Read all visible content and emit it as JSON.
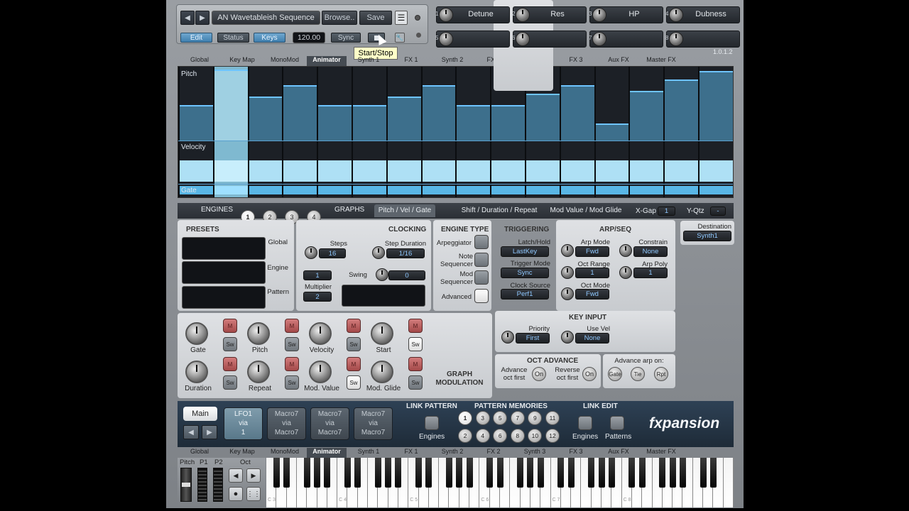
{
  "toolbar": {
    "prev": "◀",
    "next": "▶",
    "preset": "AN Wavetableish Sequence",
    "browse": "Browse..",
    "save": "Save",
    "edit": "Edit",
    "status": "Status",
    "keys": "Keys",
    "tempo": "120.00",
    "sync": "Sync",
    "version": "1.0.1.2",
    "tooltip": "Start/Stop"
  },
  "macros": [
    {
      "num": "1",
      "label": "Detune"
    },
    {
      "num": "2",
      "label": "Res"
    },
    {
      "num": "3",
      "label": "HP"
    },
    {
      "num": "4",
      "label": "Dubness"
    },
    {
      "num": "5",
      "label": ""
    },
    {
      "num": "6",
      "label": ""
    },
    {
      "num": "7",
      "label": ""
    },
    {
      "num": "8",
      "label": ""
    }
  ],
  "tabs": [
    "Global",
    "Key Map",
    "MonoMod",
    "Animator",
    "Synth 1",
    "FX 1",
    "Synth 2",
    "FX 2",
    "Synth 3",
    "FX 3",
    "Aux FX",
    "Master FX"
  ],
  "active_tab": "Animator",
  "graph": {
    "pitch_label": "Pitch",
    "velocity_label": "Velocity",
    "gate_label": "Gate",
    "pitch_values": [
      0.5,
      1.0,
      0.62,
      0.78,
      0.5,
      0.5,
      0.62,
      0.78,
      0.5,
      0.5,
      0.66,
      0.78,
      0.24,
      0.7,
      0.86,
      0.98
    ],
    "velocity_values": [
      0.55,
      1.0,
      0.55,
      0.55,
      0.55,
      0.55,
      0.55,
      0.55,
      0.55,
      0.55,
      0.55,
      0.55,
      0.55,
      0.55,
      0.55,
      0.55
    ],
    "gate_values": [
      1,
      1,
      1,
      1,
      1,
      1,
      1,
      1,
      1,
      1,
      1,
      1,
      1,
      1,
      1,
      1
    ]
  },
  "engines": {
    "label": "ENGINES",
    "items": [
      "1",
      "2",
      "3",
      "4"
    ],
    "active": "1"
  },
  "graphs": {
    "label": "GRAPHS",
    "items": [
      "Pitch / Vel / Gate",
      "Shift / Duration / Repeat",
      "Mod Value / Mod Glide"
    ],
    "active": "Pitch / Vel / Gate"
  },
  "xgap": {
    "label": "X-Gap",
    "value": "1"
  },
  "yqtz": {
    "label": "Y-Qtz",
    "value": "-"
  },
  "destination": {
    "label": "Destination",
    "value": "Synth1"
  },
  "presets": {
    "title": "PRESETS",
    "global": "Global",
    "engine": "Engine",
    "pattern": "Pattern"
  },
  "clocking": {
    "title": "CLOCKING",
    "steps_label": "Steps",
    "steps": "16",
    "step_duration_label": "Step Duration",
    "step_duration": "1/16",
    "swing_label": "Swing",
    "swing": "0",
    "mult_a": "1",
    "multiplier_label": "Multiplier",
    "multiplier": "2"
  },
  "engine_type": {
    "title": "ENGINE TYPE",
    "items": [
      "Arpeggiator",
      "Note Sequencer",
      "Mod Sequencer",
      "Advanced"
    ]
  },
  "triggering": {
    "title": "TRIGGERING",
    "latch_label": "Latch/Hold",
    "latch": "LastKey",
    "trigger_label": "Trigger Mode",
    "trigger": "Sync",
    "clock_label": "Clock Source",
    "clock": "Perf1"
  },
  "arpseq": {
    "title": "ARP/SEQ",
    "arp_mode_label": "Arp Mode",
    "arp_mode": "Fwd",
    "constrain_label": "Constrain",
    "constrain": "None",
    "oct_range_label": "Oct Range",
    "oct_range": "1",
    "arp_poly_label": "Arp Poly",
    "arp_poly": "1",
    "oct_mode_label": "Oct Mode",
    "oct_mode": "Fwd"
  },
  "key_input": {
    "title": "KEY INPUT",
    "priority_label": "Priority",
    "priority": "First",
    "use_vel_label": "Use Vel",
    "use_vel": "None"
  },
  "oct_advance": {
    "title": "OCT ADVANCE",
    "adv_label": "Advance oct first",
    "rev_label": "Reverse oct first",
    "on": "On"
  },
  "advance_arp": {
    "title": "Advance arp on:",
    "items": [
      "Gate",
      "Tie",
      "Rpt"
    ]
  },
  "graph_mod": {
    "title": "GRAPH MODULATION",
    "m": "M",
    "sw": "Sw",
    "knobs": [
      "Gate",
      "Pitch",
      "Velocity",
      "Start",
      "Duration",
      "Repeat",
      "Mod. Value",
      "Mod. Glide"
    ]
  },
  "footer": {
    "main": "Main",
    "lfo": [
      "LFO1",
      "via",
      "1"
    ],
    "macro_slots": [
      [
        "Macro7",
        "via",
        "Macro7"
      ],
      [
        "Macro7",
        "via",
        "Macro7"
      ],
      [
        "Macro7",
        "via",
        "Macro7"
      ]
    ],
    "link_pattern": "LINK PATTERN",
    "engines": "Engines",
    "pattern_memories": "PATTERN MEMORIES",
    "memories": [
      "1",
      "3",
      "5",
      "7",
      "9",
      "11",
      "2",
      "4",
      "6",
      "8",
      "10",
      "12"
    ],
    "link_edit": "LINK EDIT",
    "patterns": "Patterns",
    "brand": "fxpansion"
  },
  "keyboard": {
    "pitch": "Pitch",
    "p1": "P1",
    "p2": "P2",
    "oct": "Oct",
    "octaves": [
      "C 3",
      "C 4",
      "C 5",
      "C 6",
      "C 7",
      "C 8"
    ]
  }
}
